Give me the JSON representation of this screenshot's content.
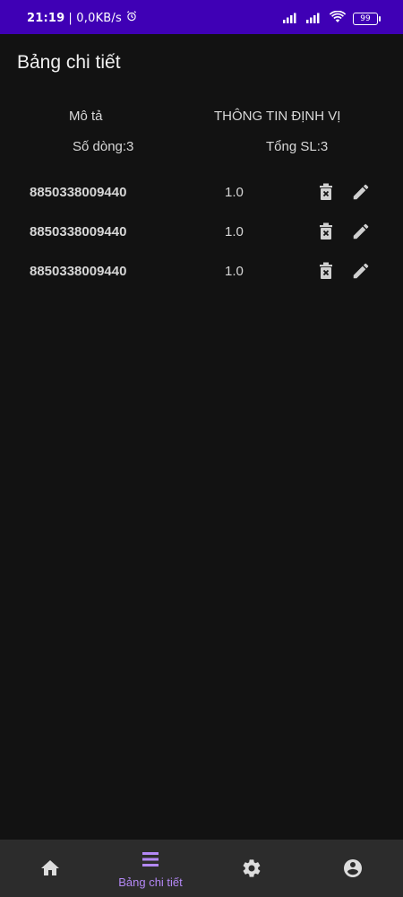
{
  "status_bar": {
    "time": "21:19",
    "net_speed": "| 0,0KB/s",
    "battery": "99"
  },
  "header": {
    "title": "Bảng chi tiết"
  },
  "table": {
    "col_desc_label": "Mô tả",
    "col_info_label": "THÔNG TIN ĐỊNH VỊ",
    "row_count_label": "Số dòng:3",
    "total_qty_label": "Tổng SL:3",
    "rows": [
      {
        "code": "8850338009440",
        "qty": "1.0"
      },
      {
        "code": "8850338009440",
        "qty": "1.0"
      },
      {
        "code": "8850338009440",
        "qty": "1.0"
      }
    ]
  },
  "bottom_nav": {
    "items": [
      {
        "icon": "home-icon",
        "label": ""
      },
      {
        "icon": "list-icon",
        "label": "Bảng chi tiết",
        "active": true
      },
      {
        "icon": "gear-icon",
        "label": ""
      },
      {
        "icon": "account-icon",
        "label": ""
      }
    ],
    "active_color": "#b388f5",
    "inactive_color": "#dddddd"
  },
  "colors": {
    "status_bar_bg": "#3f00b5",
    "background": "#121212",
    "nav_bg": "#2c2c2c"
  }
}
